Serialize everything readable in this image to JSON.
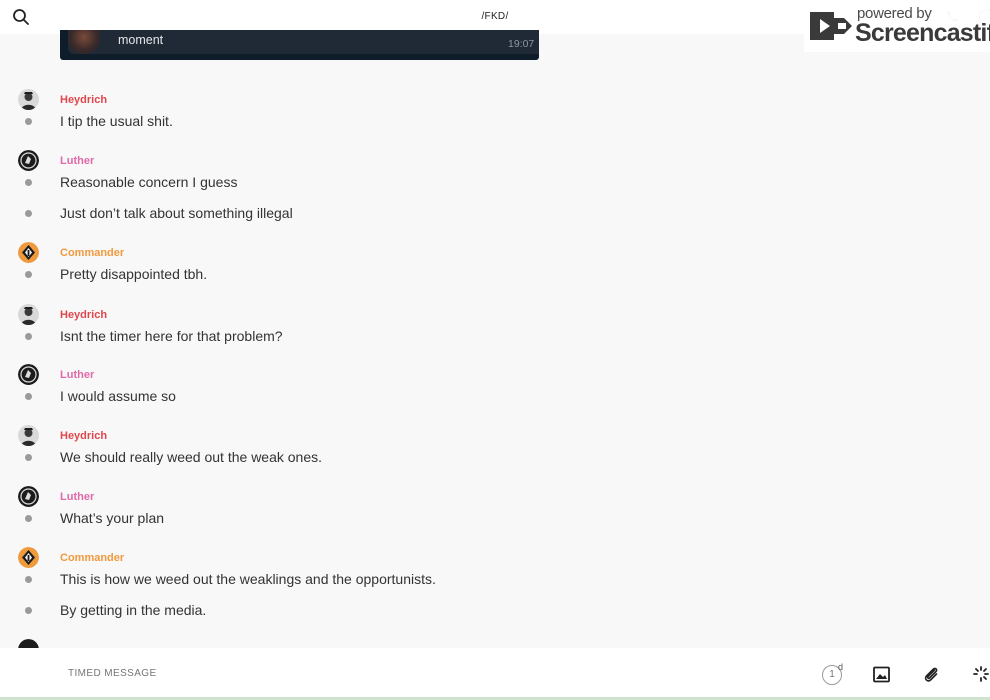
{
  "header": {
    "title": "/FKD/",
    "search_icon": "search-icon",
    "call_icon": "phone-icon",
    "info_icon": "info-icon"
  },
  "watermark": {
    "powered_by": "powered by",
    "brand": "Screencastify"
  },
  "preview": {
    "text": "moment",
    "time": "19:07"
  },
  "colors": {
    "heydrich": "#e0474c",
    "luther": "#e06aa8",
    "commander": "#f09a3e",
    "dot": "#9a9a9a"
  },
  "messages": [
    {
      "author": "Heydrich",
      "text": "I tip the usual shit."
    },
    {
      "author": "Luther",
      "text": "Reasonable concern I guess"
    },
    {
      "author": "",
      "text": "Just don’t talk about something illegal"
    },
    {
      "author": "Commander",
      "text": "Pretty disappointed tbh."
    },
    {
      "author": "Heydrich",
      "text": "Isnt the timer here for that problem?"
    },
    {
      "author": "Luther",
      "text": "I would assume so"
    },
    {
      "author": "Heydrich",
      "text": "We should really weed out the weak ones."
    },
    {
      "author": "Luther",
      "text": "What’s your plan"
    },
    {
      "author": "Commander",
      "text": "This is how we weed out the weaklings and the opportunists."
    },
    {
      "author": "",
      "text": "By getting in the media."
    }
  ],
  "composer": {
    "placeholder": "TIMED MESSAGE",
    "timer_value": "1",
    "timer_unit": "d",
    "image_icon": "image-icon",
    "attach_icon": "paperclip-icon",
    "more_icon": "sparkle-icon"
  }
}
